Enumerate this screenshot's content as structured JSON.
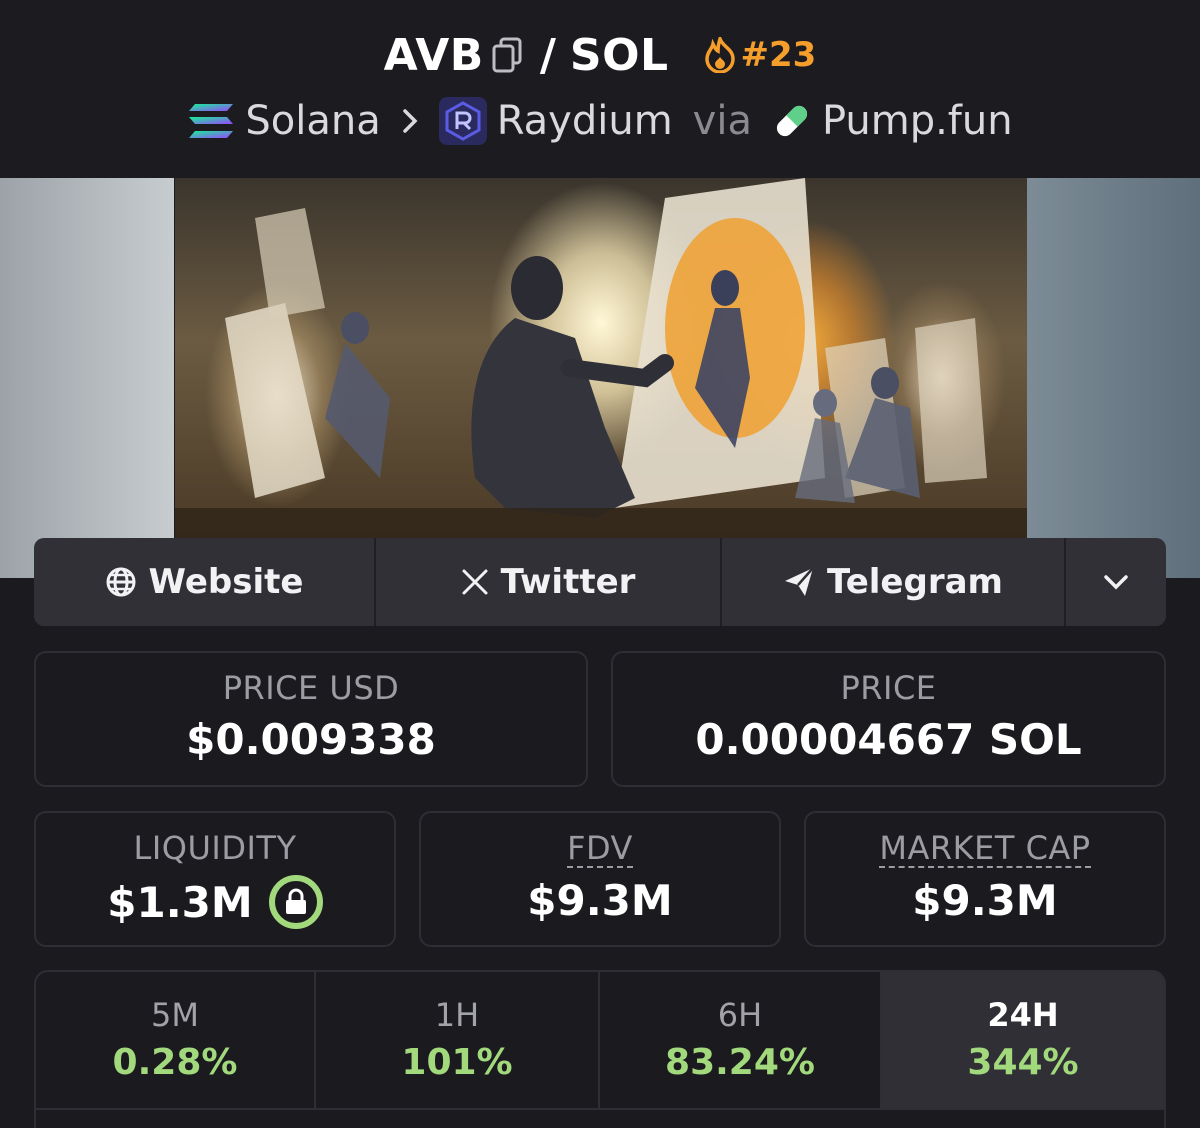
{
  "header": {
    "token": "AVB",
    "separator": "/",
    "quote": "SOL",
    "rank": "#23",
    "chain": "Solana",
    "dex": "Raydium",
    "via_text": "via",
    "launchpad": "Pump.fun",
    "icons": {
      "copy": "copy-icon",
      "rank": "fire-icon",
      "chain": "solana-logo-icon",
      "breadcrumb": "chevron-right-icon",
      "dex": "raydium-logo-icon",
      "launchpad": "pill-icon"
    },
    "colors": {
      "rank": "#f59e2b",
      "via": "#8a8a90"
    }
  },
  "banner": {
    "image": "ai-painter-robots-artwork"
  },
  "links": {
    "website": "Website",
    "twitter": "Twitter",
    "telegram": "Telegram",
    "icons": [
      "globe-icon",
      "x-logo-icon",
      "telegram-icon",
      "chevron-down-icon"
    ]
  },
  "stats": {
    "price_usd_label": "PRICE USD",
    "price_usd": "$0.009338",
    "price_label": "PRICE",
    "price": "0.00004667 SOL",
    "liquidity_label": "LIQUIDITY",
    "liquidity": "$1.3M",
    "fdv_label": "FDV",
    "fdv": "$9.3M",
    "mcap_label": "MARKET CAP",
    "mcap": "$9.3M"
  },
  "timeframes": [
    {
      "label": "5M",
      "change": "0.28%"
    },
    {
      "label": "1H",
      "change": "101%"
    },
    {
      "label": "6H",
      "change": "83.24%"
    },
    {
      "label": "24H",
      "change": "344%",
      "selected": true
    }
  ],
  "colors": {
    "positive": "#a3d97d",
    "background": "#1a1a1f",
    "panel": "#303036"
  }
}
